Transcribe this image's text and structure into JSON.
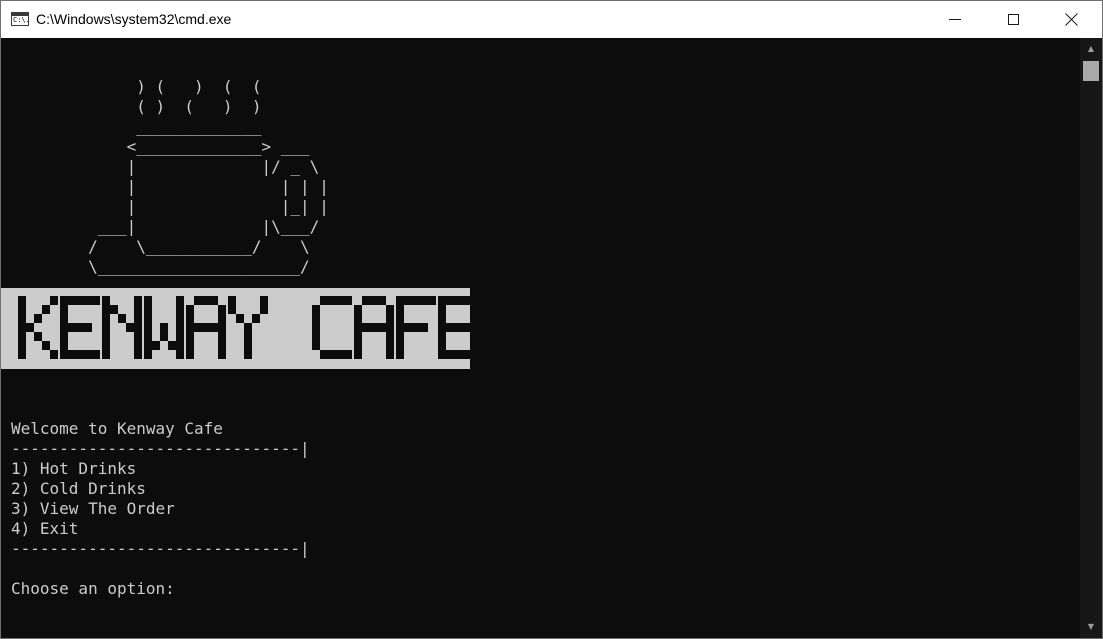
{
  "window": {
    "title": "C:\\Windows\\system32\\cmd.exe",
    "icon": "cmd-console-icon",
    "icon_glyph": "C:\\."
  },
  "controls": {
    "minimize": "minimize-icon",
    "maximize": "maximize-icon",
    "close": "close-icon"
  },
  "console": {
    "background": "#0c0c0c",
    "foreground": "#cccccc",
    "ascii_art": [
      "             ) (   )  (  (",
      "             ( )  (   )  )",
      "             _____________",
      "            <_____________> ___",
      "            |             |/ _ \\",
      "            |               | | |",
      "            |               |_| |",
      "         ___|             |\\___/",
      "        /    \\___________/    \\",
      "        \\_____________________/"
    ],
    "banner": {
      "text": "KENWAY CAFE",
      "background": "#cccccc",
      "foreground": "#0c0c0c"
    },
    "lines": [
      "Welcome to Kenway Cafe",
      "------------------------------|",
      "1) Hot Drinks",
      "2) Cold Drinks",
      "3) View The Order",
      "4) Exit",
      "------------------------------|",
      "",
      "Choose an option:"
    ]
  }
}
